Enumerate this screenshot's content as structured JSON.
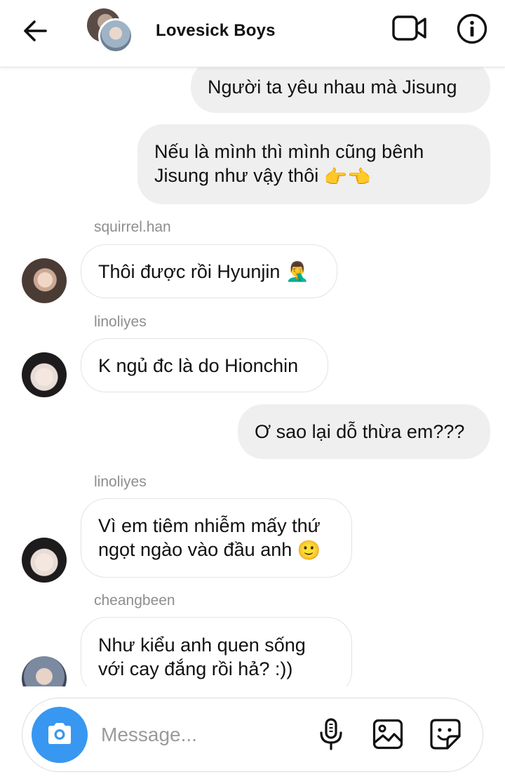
{
  "header": {
    "title": "Lovesick Boys",
    "back_icon": "arrow-left-icon",
    "video_icon": "video-camera-icon",
    "info_icon": "info-icon"
  },
  "messages": [
    {
      "direction": "out",
      "text": "Người ta yêu nhau mà Jisung"
    },
    {
      "direction": "out",
      "line1": "Nếu là mình thì mình cũng bênh",
      "line2": "Jisung như vậy thôi",
      "emoji": "👉👈"
    },
    {
      "direction": "in",
      "sender": "squirrel.han",
      "text": "Thôi được rồi Hyunjin",
      "emoji": "🤦‍♂️"
    },
    {
      "direction": "in",
      "sender": "linoliyes",
      "text": "K ngủ đc là do Hionchin"
    },
    {
      "direction": "out",
      "text": "Ơ sao lại dỗ thừa em???"
    },
    {
      "direction": "in",
      "sender": "linoliyes",
      "line1": "Vì em tiêm nhiễm mấy thứ",
      "line2": "ngọt ngào vào đầu anh",
      "emoji": "🙂"
    },
    {
      "direction": "in",
      "sender": "cheangbeen",
      "line1": "Như kiểu anh quen sống",
      "line2": "với cay đắng rồi hả? :))"
    }
  ],
  "composer": {
    "placeholder": "Message...",
    "camera_icon": "camera-icon",
    "mic_icon": "microphone-icon",
    "gallery_icon": "gallery-icon",
    "sticker_icon": "sticker-icon"
  },
  "colors": {
    "accent": "#3897f0",
    "outgoing_bubble": "#efefef",
    "incoming_border": "#e3e3e3",
    "sender_text": "#8e8e8e"
  }
}
